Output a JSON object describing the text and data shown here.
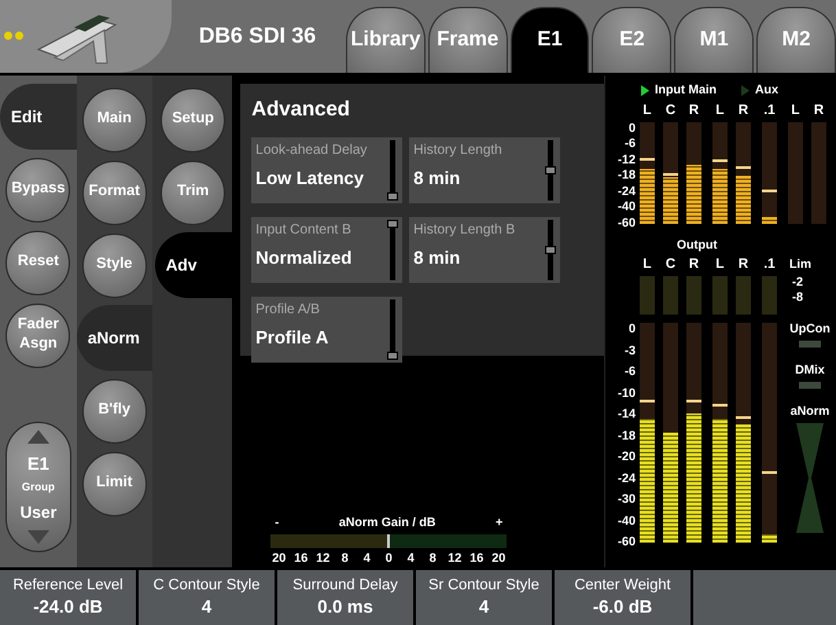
{
  "header": {
    "title": "DB6 SDI 36"
  },
  "tabs": [
    {
      "label": "Library",
      "selected": false
    },
    {
      "label": "Frame",
      "selected": false
    },
    {
      "label": "E1",
      "selected": true
    },
    {
      "label": "E2",
      "selected": false
    },
    {
      "label": "M1",
      "selected": false
    },
    {
      "label": "M2",
      "selected": false
    }
  ],
  "nav_columns": [
    {
      "items": [
        {
          "label": "Edit",
          "selected": true
        },
        {
          "label": "Bypass",
          "selected": false
        },
        {
          "label": "Reset",
          "selected": false
        },
        {
          "label": "Fader Asgn",
          "selected": false
        }
      ]
    },
    {
      "items": [
        {
          "label": "Main",
          "selected": false
        },
        {
          "label": "Format",
          "selected": false
        },
        {
          "label": "Style",
          "selected": false
        },
        {
          "label": "aNorm",
          "selected": true
        },
        {
          "label": "B'fly",
          "selected": false
        },
        {
          "label": "Limit",
          "selected": false
        }
      ]
    },
    {
      "items": [
        {
          "label": "Setup",
          "selected": false
        },
        {
          "label": "Trim",
          "selected": false
        },
        {
          "label": "Adv",
          "selected": true
        }
      ]
    }
  ],
  "group_control": {
    "value": "E1",
    "label": "Group",
    "mode": "User"
  },
  "panel": {
    "title": "Advanced",
    "params": [
      {
        "label": "Look-ahead Delay",
        "value": "Low Latency",
        "level": 0
      },
      {
        "label": "History Length",
        "value": "8 min",
        "level": 0.5
      },
      {
        "label": "Input Content B",
        "value": "Normalized",
        "level": 1
      },
      {
        "label": "History Length B",
        "value": "8 min",
        "level": 0.5
      },
      {
        "label": "Profile A/B",
        "value": "Profile A",
        "level": 0
      }
    ]
  },
  "gain_meter": {
    "title": "aNorm Gain / dB",
    "minus": "-",
    "plus": "+",
    "scale": [
      "20",
      "16",
      "12",
      "8",
      "4",
      "0",
      "4",
      "8",
      "12",
      "16",
      "20"
    ],
    "level": 0.5
  },
  "input_meters": {
    "title": "Input Main",
    "active": true,
    "aux_title": "Aux",
    "aux_active": false,
    "scale": [
      "0",
      "-6",
      "-12",
      "-18",
      "-24",
      "-40",
      "-60"
    ],
    "groups": [
      {
        "channels": [
          {
            "label": "L",
            "level": 0.53,
            "peak": {
              "level": 0.61
            }
          },
          {
            "label": "C",
            "level": 0.45,
            "peak": {
              "level": 0.47
            }
          },
          {
            "label": "R",
            "level": 0.58
          }
        ]
      },
      {
        "channels": [
          {
            "label": "L",
            "level": 0.53,
            "peak": {
              "level": 0.6
            }
          },
          {
            "label": "R",
            "level": 0.47,
            "peak": {
              "level": 0.53
            }
          }
        ]
      },
      {
        "channels": [
          {
            "label": ".1",
            "level": 0.06,
            "peak": {
              "level": 0.3
            }
          }
        ]
      },
      {
        "channels": [
          {
            "label": "L"
          },
          {
            "label": "R"
          }
        ]
      }
    ]
  },
  "output_meters": {
    "title": "Output",
    "scale": [
      "0",
      "-3",
      "-6",
      "-10",
      "-14",
      "-18",
      "-20",
      "-24",
      "-30",
      "-40",
      "-60"
    ],
    "groups": [
      {
        "channels": [
          {
            "label": "L",
            "level": 0.56,
            "peak": {
              "level": 0.64
            }
          },
          {
            "label": "C",
            "level": 0.5
          },
          {
            "label": "R",
            "level": 0.59,
            "peak": {
              "level": 0.64
            }
          }
        ]
      },
      {
        "channels": [
          {
            "label": "L",
            "level": 0.56,
            "peak": {
              "level": 0.62
            }
          },
          {
            "label": "R",
            "level": 0.54,
            "peak": {
              "level": 0.56
            }
          }
        ]
      },
      {
        "channels": [
          {
            "label": ".1",
            "level": 0.04,
            "peak": {
              "level": 0.31
            }
          }
        ]
      }
    ],
    "lim": {
      "label": "Lim",
      "scale": [
        "-2",
        "-8"
      ]
    },
    "indicators": [
      {
        "label": "UpCon",
        "kind": "lamp"
      },
      {
        "label": "DMix",
        "kind": "lamp"
      },
      {
        "label": "aNorm",
        "kind": "hourglass"
      }
    ]
  },
  "bottom_params": [
    {
      "label": "Reference Level",
      "value": "-24.0 dB"
    },
    {
      "label": "C Contour Style",
      "value": "4"
    },
    {
      "label": "Surround Delay",
      "value": "0.0 ms"
    },
    {
      "label": "Sr Contour Style",
      "value": "4"
    },
    {
      "label": "Center Weight",
      "value": "-6.0 dB"
    }
  ]
}
